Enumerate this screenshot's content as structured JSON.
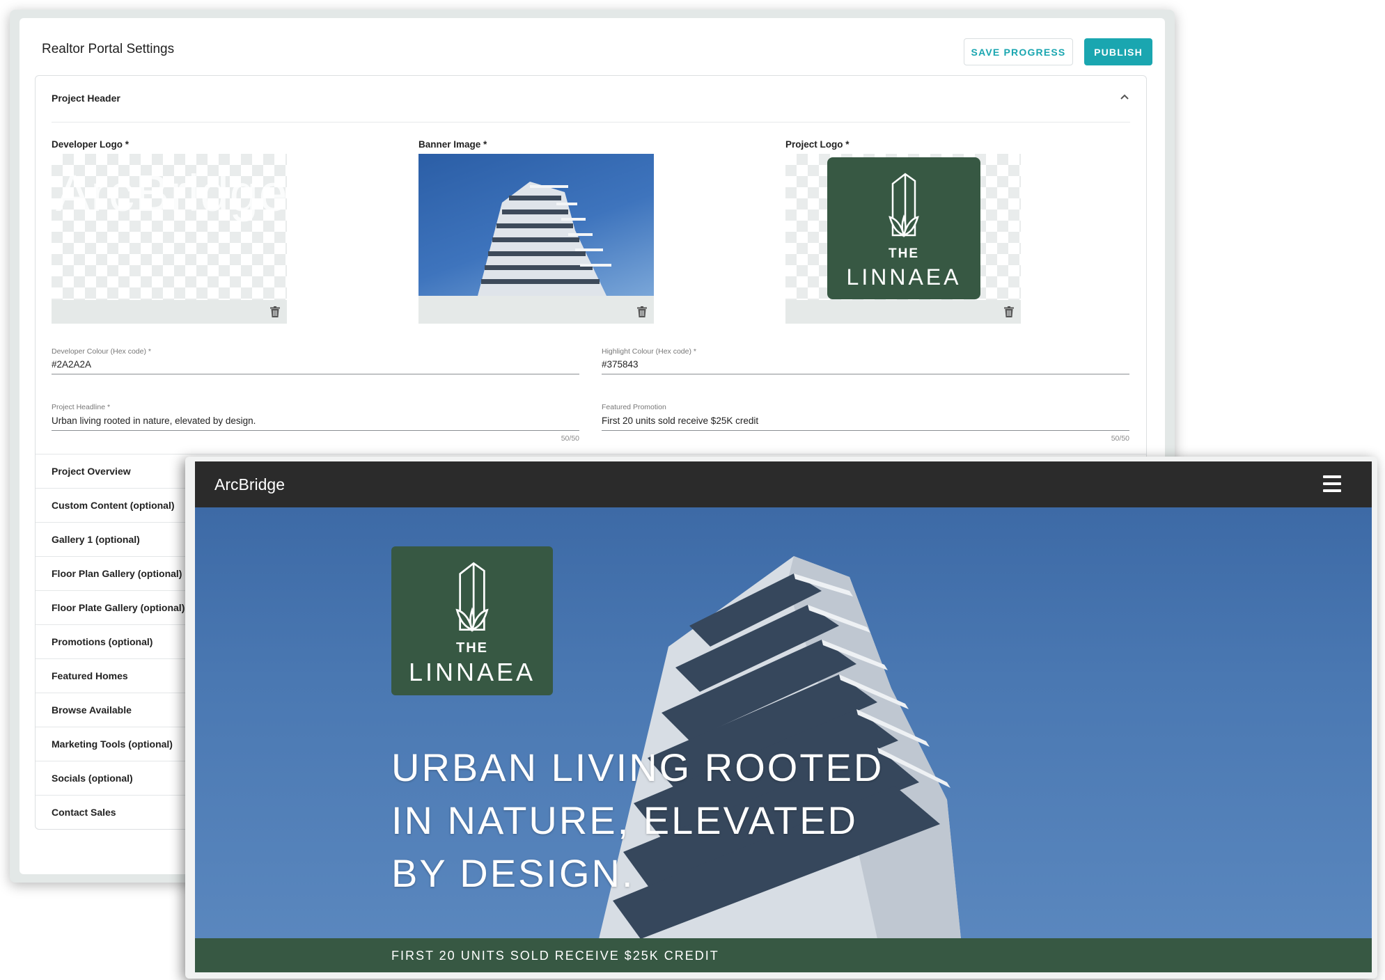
{
  "settings": {
    "title": "Realtor Portal Settings",
    "save_label": "SAVE PROGRESS",
    "publish_label": "PUBLISH",
    "accent_color": "#1aa6b0",
    "header_panel": {
      "label": "Project Header",
      "uploads": {
        "developer_logo_label": "Developer Logo *",
        "developer_logo_text": "ArcBridge",
        "banner_image_label": "Banner Image *",
        "project_logo_label": "Project Logo *"
      },
      "fields": {
        "developer_colour": {
          "label": "Developer Colour (Hex code) *",
          "value": "#2A2A2A"
        },
        "highlight_colour": {
          "label": "Highlight Colour (Hex code) *",
          "value": "#375843"
        },
        "project_headline": {
          "label": "Project Headline *",
          "value": "Urban living rooted in nature, elevated by design.",
          "counter": "50/50"
        },
        "featured_promotion": {
          "label": "Featured Promotion",
          "value": "First 20 units sold receive $25K credit",
          "counter": "50/50"
        }
      }
    },
    "sections": [
      "Project Overview",
      "Custom Content (optional)",
      "Gallery 1 (optional)",
      "Floor Plan Gallery (optional)",
      "Floor Plate Gallery (optional)",
      "Promotions (optional)",
      "Featured Homes",
      "Browse Available",
      "Marketing Tools (optional)",
      "Socials (optional)",
      "Contact Sales"
    ]
  },
  "logo": {
    "the": "THE",
    "name": "LINNAEA",
    "color": "#375843"
  },
  "preview": {
    "brand": "ArcBridge",
    "nav_color": "#2A2A2A",
    "headline": "Urban living rooted in nature, elevated by design.",
    "promotion": "First 20 units sold receive $25K credit"
  }
}
